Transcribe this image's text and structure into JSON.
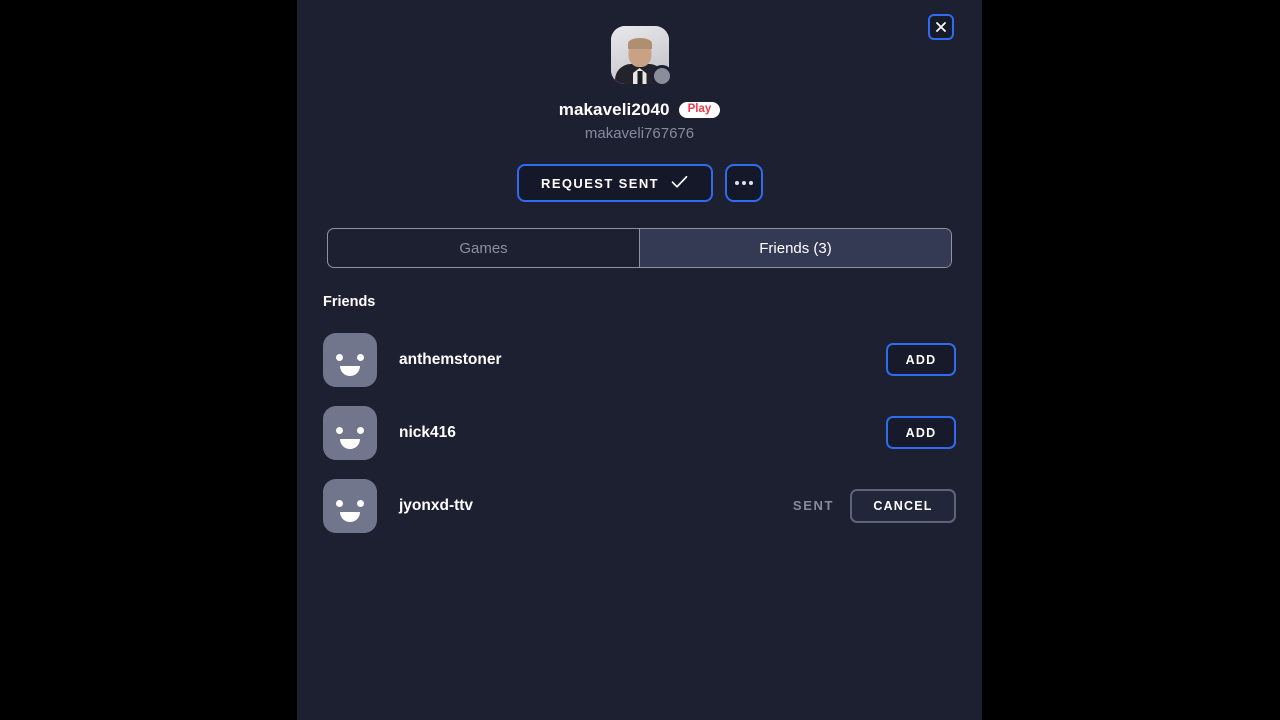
{
  "window": {
    "background_color": "#000000",
    "panel_color": "#1d2031"
  },
  "colors": {
    "accent_blue": "#2f6bf0",
    "muted_text": "#868a9c",
    "badge_red": "#f0384c",
    "active_tab_bg": "#343a54"
  },
  "close_button": {
    "icon": "close-icon",
    "label": "×"
  },
  "profile": {
    "avatar_icon": "user-photo-avatar",
    "status": "offline",
    "display_name": "makaveli2040",
    "badge_label": "Play",
    "handle": "makaveli767676"
  },
  "actions": {
    "primary_label": "REQUEST SENT",
    "primary_icon": "check-icon",
    "more_icon": "more-horizontal-icon"
  },
  "tabs": [
    {
      "label": "Games",
      "active": false
    },
    {
      "label": "Friends (3)",
      "active": true
    }
  ],
  "friends_section": {
    "title": "Friends",
    "rows": [
      {
        "avatar_icon": "smiley-avatar-icon",
        "name": "anthemstoner",
        "status_label": "",
        "button_label": "ADD",
        "button_style": "add"
      },
      {
        "avatar_icon": "smiley-avatar-icon",
        "name": "nick416",
        "status_label": "",
        "button_label": "ADD",
        "button_style": "add"
      },
      {
        "avatar_icon": "smiley-avatar-icon",
        "name": "jyonxd-ttv",
        "status_label": "SENT",
        "button_label": "CANCEL",
        "button_style": "cancel"
      }
    ]
  }
}
